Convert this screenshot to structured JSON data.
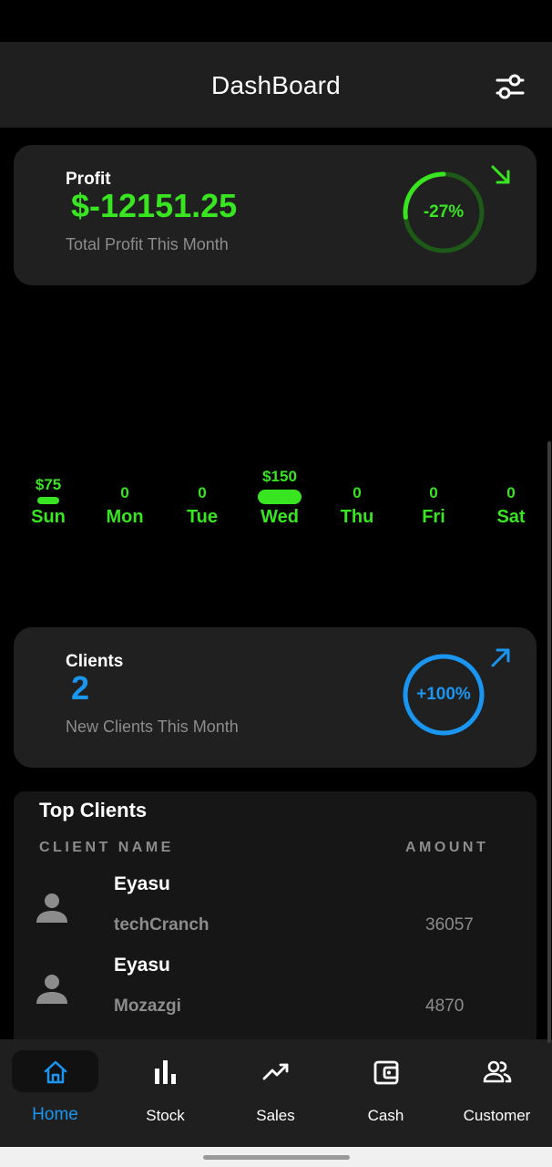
{
  "app": {
    "title": "DashBoard"
  },
  "profit_card": {
    "label": "Profit",
    "value": "$-12151.25",
    "subtitle": "Total Profit This Month",
    "change": "-27%",
    "change_fraction": 0.27,
    "trend_icon": "arrow-down-right-icon",
    "accent_color": "#39e520"
  },
  "week": {
    "days": [
      {
        "name": "Sun",
        "value": "$75",
        "amount": 75
      },
      {
        "name": "Mon",
        "value": "0",
        "amount": 0
      },
      {
        "name": "Tue",
        "value": "0",
        "amount": 0
      },
      {
        "name": "Wed",
        "value": "$150",
        "amount": 150
      },
      {
        "name": "Thu",
        "value": "0",
        "amount": 0
      },
      {
        "name": "Fri",
        "value": "0",
        "amount": 0
      },
      {
        "name": "Sat",
        "value": "0",
        "amount": 0
      }
    ],
    "accent_color": "#39e520"
  },
  "clients_card": {
    "label": "Clients",
    "value": "2",
    "subtitle": "New Clients This Month",
    "change": "+100%",
    "change_fraction": 1.0,
    "trend_icon": "arrow-up-right-icon",
    "accent_color": "#1a96f0"
  },
  "top_clients": {
    "heading": "Top Clients",
    "columns": {
      "name": "CLIENT NAME",
      "amount": "AMOUNT"
    },
    "rows": [
      {
        "name": "Eyasu",
        "company": "techCranch",
        "amount": "36057"
      },
      {
        "name": "Eyasu",
        "company": "Mozazgi",
        "amount": "4870"
      }
    ]
  },
  "bottom_nav": {
    "items": [
      {
        "label": "Home",
        "icon": "home-icon",
        "active": true
      },
      {
        "label": "Stock",
        "icon": "bar-chart-icon",
        "active": false
      },
      {
        "label": "Sales",
        "icon": "trending-up-icon",
        "active": false
      },
      {
        "label": "Cash",
        "icon": "wallet-icon",
        "active": false
      },
      {
        "label": "Customer",
        "icon": "people-icon",
        "active": false
      }
    ],
    "active_color": "#1a96f0"
  }
}
